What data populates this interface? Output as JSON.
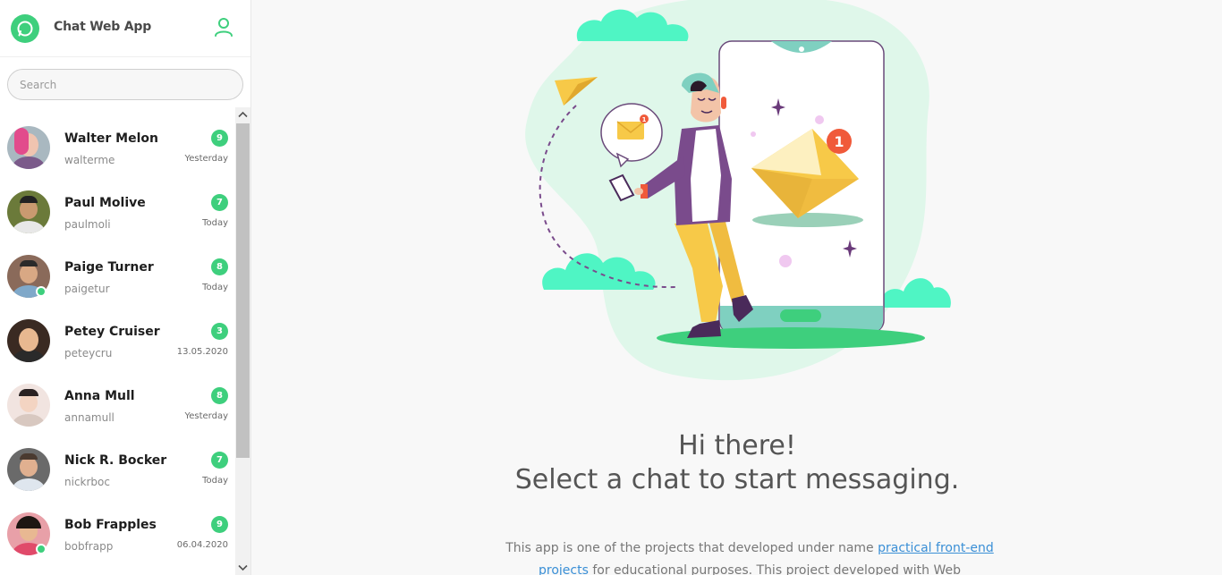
{
  "app": {
    "title": "Chat Web App"
  },
  "search": {
    "placeholder": "Search"
  },
  "colors": {
    "accent": "#3ecf7d",
    "badge": "#3ecf7d",
    "link": "#3a8fd6"
  },
  "icons": {
    "logo": "whatsapp-chat-icon",
    "profile": "user-icon",
    "scroll_up": "chevron-up-icon",
    "scroll_down": "chevron-down-icon"
  },
  "chats": [
    {
      "name": "Walter Melon",
      "username": "walterme",
      "unread": "9",
      "time": "Yesterday",
      "online": false
    },
    {
      "name": "Paul Molive",
      "username": "paulmoli",
      "unread": "7",
      "time": "Today",
      "online": false
    },
    {
      "name": "Paige Turner",
      "username": "paigetur",
      "unread": "8",
      "time": "Today",
      "online": true
    },
    {
      "name": "Petey Cruiser",
      "username": "peteycru",
      "unread": "3",
      "time": "13.05.2020",
      "online": false
    },
    {
      "name": "Anna Mull",
      "username": "annamull",
      "unread": "8",
      "time": "Yesterday",
      "online": false
    },
    {
      "name": "Nick R. Bocker",
      "username": "nickrboc",
      "unread": "7",
      "time": "Today",
      "online": false
    },
    {
      "name": "Bob Frapples",
      "username": "bobfrapp",
      "unread": "9",
      "time": "06.04.2020",
      "online": true
    }
  ],
  "welcome": {
    "title": "Hi there!",
    "subtitle": "Select a chat to start messaging.",
    "desc_before": "This app is one of the projects that developed under name ",
    "desc_link": "practical front-end projects",
    "desc_after": " for educational purposes. This project developed with Web"
  },
  "illustration": {
    "notification_count": "1",
    "mini_notification_count": "1"
  }
}
